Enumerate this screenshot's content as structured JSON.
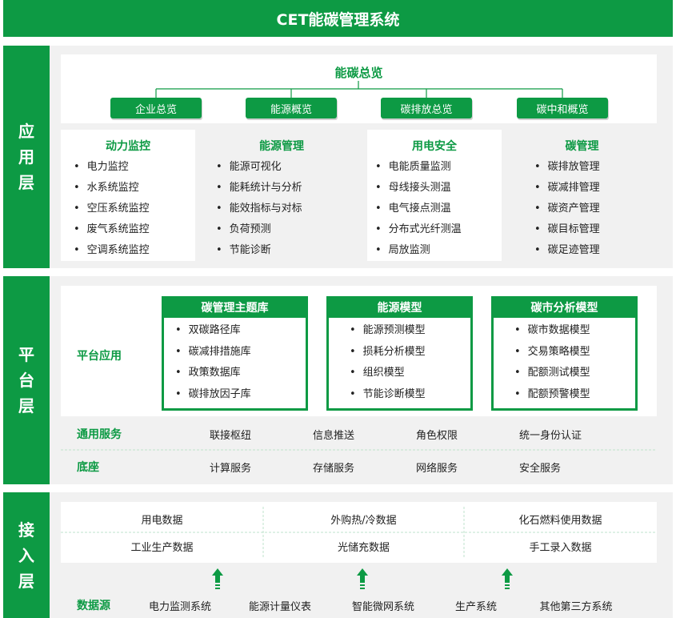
{
  "title": "CET能碳管理系统",
  "colors": {
    "accent": "#0d9a44",
    "panel": "#f1f1f1"
  },
  "layers": {
    "app": {
      "label": [
        "应",
        "用",
        "层"
      ]
    },
    "platform": {
      "label": [
        "平",
        "台",
        "层"
      ]
    },
    "access": {
      "label": [
        "接",
        "入",
        "层"
      ]
    }
  },
  "overview": {
    "root": "能碳总览",
    "children": [
      "企业总览",
      "能源概览",
      "碳排放总览",
      "碳中和概览"
    ]
  },
  "app_columns": [
    {
      "title": "动力监控",
      "items": [
        "电力监控",
        "水系统监控",
        "空压系统监控",
        "废气系统监控",
        "空调系统监控"
      ]
    },
    {
      "title": "能源管理",
      "items": [
        "能源可视化",
        "能耗统计与分析",
        "能效指标与对标",
        "负荷预测",
        "节能诊断"
      ]
    },
    {
      "title": "用电安全",
      "items": [
        "电能质量监测",
        "母线接头测温",
        "电气接点测温",
        "分布式光纤测温",
        "局放监测"
      ]
    },
    {
      "title": "碳管理",
      "items": [
        "碳排放管理",
        "碳减排管理",
        "碳资产管理",
        "碳目标管理",
        "碳足迹管理"
      ]
    }
  ],
  "platform": {
    "app_label": "平台应用",
    "models": [
      {
        "title": "碳管理主题库",
        "items": [
          "双碳路径库",
          "碳减排措施库",
          "政策数据库",
          "碳排放因子库"
        ]
      },
      {
        "title": "能源模型",
        "items": [
          "能源预测模型",
          "损耗分析模型",
          "组织模型",
          "节能诊断模型"
        ]
      },
      {
        "title": "碳市分析模型",
        "items": [
          "碳市数据模型",
          "交易策略模型",
          "配额测试模型",
          "配额预警模型"
        ]
      }
    ],
    "common": {
      "label": "通用服务",
      "items": [
        "联接枢纽",
        "信息推送",
        "角色权限",
        "统一身份认证"
      ]
    },
    "base": {
      "label": "底座",
      "items": [
        "计算服务",
        "存储服务",
        "网络服务",
        "安全服务"
      ]
    }
  },
  "access": {
    "data_rows": [
      [
        "用电数据",
        "外购热/冷数据",
        "化石燃料使用数据"
      ],
      [
        "工业生产数据",
        "光储充数据",
        "手工录入数据"
      ]
    ],
    "source_label": "数据源",
    "sources": [
      "电力监测系统",
      "能源计量仪表",
      "智能微网系统",
      "生产系统",
      "其他第三方系统"
    ]
  }
}
